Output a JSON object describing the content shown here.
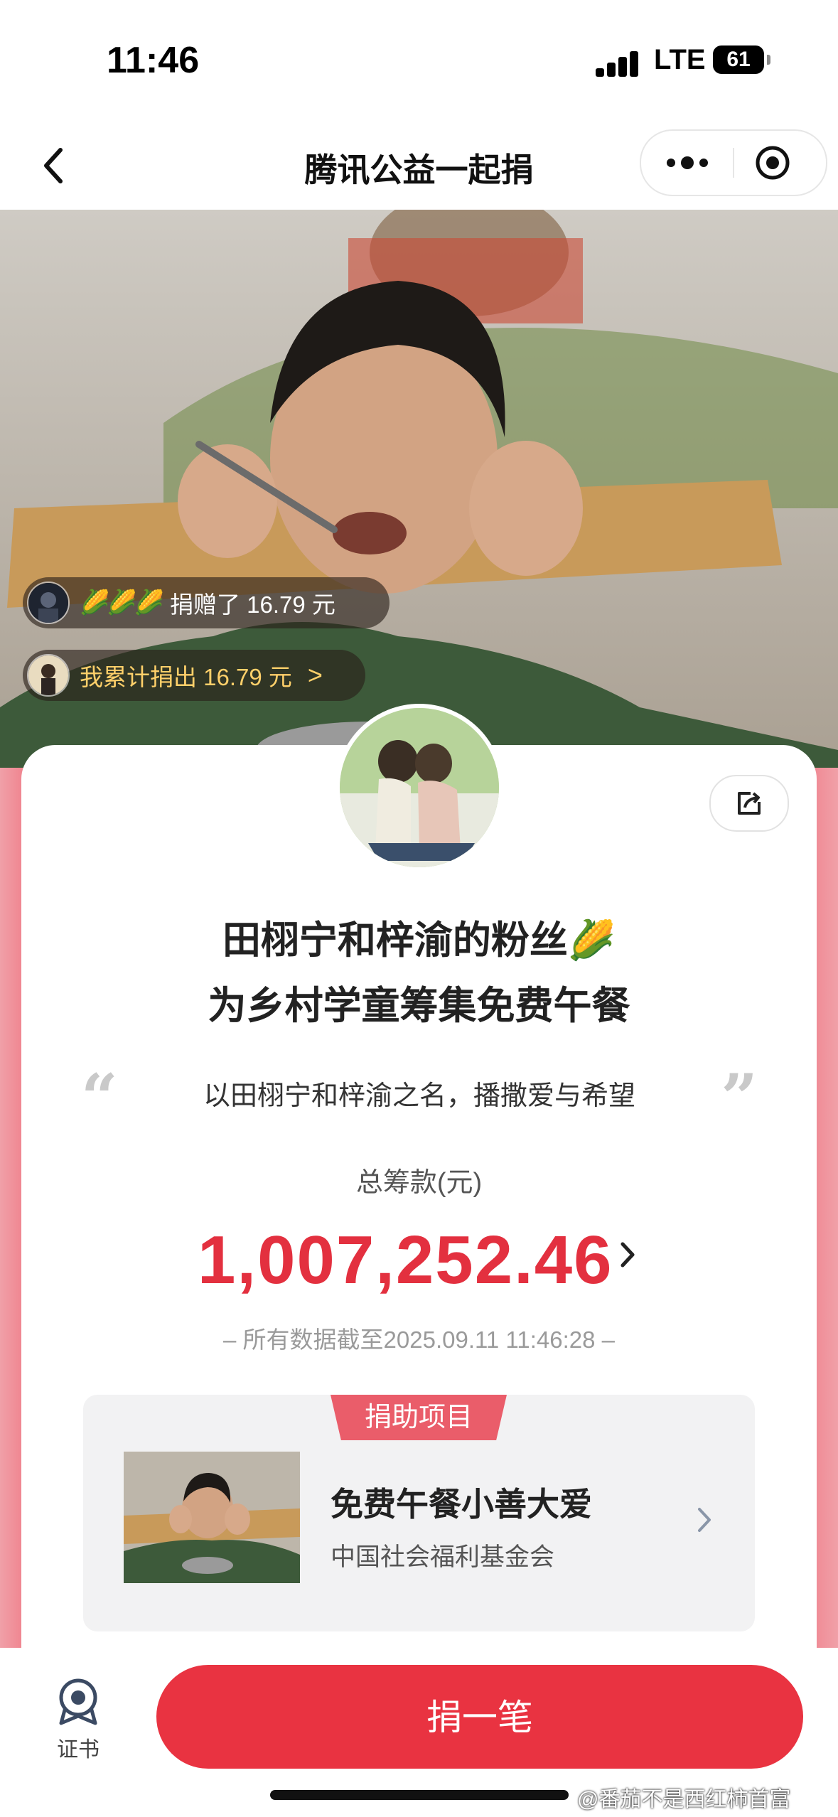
{
  "status_bar": {
    "time": "11:46",
    "network": "LTE",
    "battery": "61"
  },
  "nav": {
    "title": "腾讯公益一起捐"
  },
  "hero": {
    "donation_ticker": {
      "prefix_emoji": "🌽🌽🌽",
      "text": "捐赠了 16.79 元"
    },
    "my_total": {
      "text": "我累计捐出 16.79 元",
      "chevron": ">"
    }
  },
  "campaign": {
    "title_line1": "田栩宁和梓渝的粉丝🌽",
    "title_line2": "为乡村学童筹集免费午餐",
    "slogan": "以田栩宁和梓渝之名，播撒爱与希望",
    "open_quote": "“",
    "close_quote": "”",
    "total_label": "总筹款(元)",
    "total_amount": "1,007,252.46",
    "as_of": "– 所有数据截至2025.09.11 11:46:28 –"
  },
  "project": {
    "tag": "捐助项目",
    "name": "免费午餐小善大爱",
    "org": "中国社会福利基金会"
  },
  "bottom_bar": {
    "certificate_label": "证书",
    "donate_label": "捐一笔"
  },
  "watermark": "@番茄不是西红柿首富",
  "colors": {
    "accent_red": "#e93341",
    "amount_red": "#e3303f",
    "tag_red": "#ea5d6a",
    "gold_text": "#ffd06a"
  }
}
